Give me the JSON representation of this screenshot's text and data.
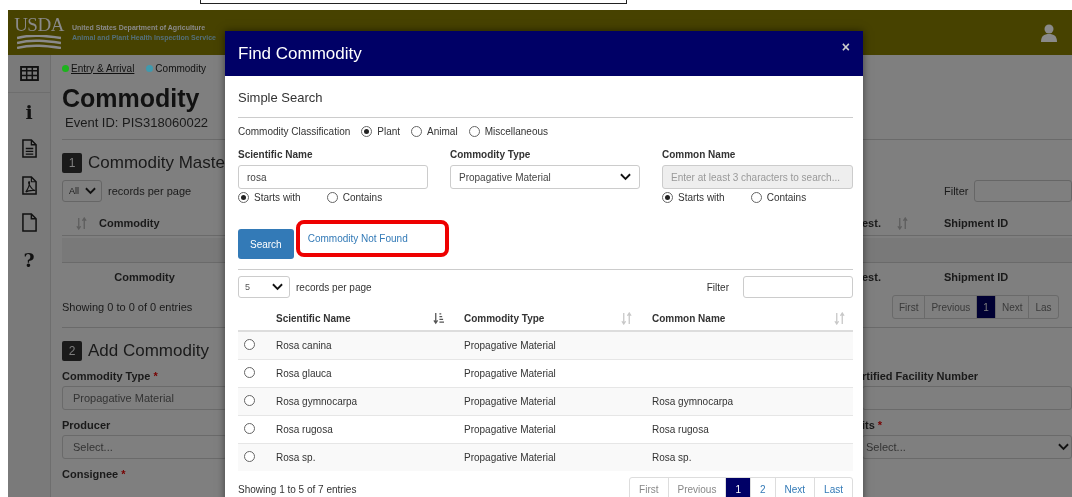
{
  "header": {
    "logo": "USDA",
    "title": "United States Department of Agriculture",
    "subtitle": "Animal and Plant Health Inspection Service"
  },
  "sidebar": {
    "items": [
      {
        "kind": "table"
      },
      {
        "kind": "glyph",
        "glyph": "i"
      },
      {
        "kind": "document"
      },
      {
        "kind": "pdf"
      },
      {
        "kind": "file"
      },
      {
        "kind": "glyph",
        "glyph": "?"
      }
    ]
  },
  "page": {
    "breadcrumbs": [
      {
        "label": "Entry & Arrival",
        "color": "#1db41d",
        "link": true
      },
      {
        "label": "Commodity",
        "color": "#3f9aae",
        "link": false
      }
    ],
    "title": "Commodity",
    "event_id": "Event ID: PIS318060022",
    "master": {
      "number": "1",
      "title": "Commodity Maste",
      "length_value": "All",
      "length_label": "records per page",
      "filter_label": "Filter",
      "columns_left": [
        {
          "label": "Commodity",
          "sorted": false
        }
      ],
      "columns_right": [
        {
          "label": "est.",
          "sorted": false
        },
        {
          "label": "Shipment ID"
        }
      ],
      "footer_left": [
        "Commodity"
      ],
      "footer_right": [
        "est.",
        "Shipment ID"
      ],
      "info": "Showing 0 to 0 of 0 entries",
      "pagination": [
        {
          "label": "First",
          "selected": false
        },
        {
          "label": "Previous",
          "selected": false
        },
        {
          "label": "1",
          "selected": true
        },
        {
          "label": "Next",
          "selected": false
        },
        {
          "label": "Las",
          "selected": false
        }
      ]
    },
    "add": {
      "number": "2",
      "title": "Add Commodity",
      "fields_left": [
        {
          "label": "Commodity Type",
          "required_mark": "*",
          "kind": "input",
          "value": "Propagative Material"
        },
        {
          "label": "Producer",
          "kind": "input",
          "placeholder": "Select..."
        },
        {
          "label": "Consignee",
          "required_mark": "*",
          "kind": "label"
        }
      ],
      "fields_right": [
        {
          "label": "rtified Facility Number",
          "kind": "input"
        },
        {
          "label": "its",
          "required_mark": "*",
          "kind": "select",
          "placeholder": "Select..."
        }
      ]
    }
  },
  "modal": {
    "title": "Find Commodity",
    "close": "×",
    "section": "Simple Search",
    "classification": {
      "label": "Commodity Classification",
      "options": [
        {
          "label": "Plant",
          "selected": true
        },
        {
          "label": "Animal",
          "selected": false
        },
        {
          "label": "Miscellaneous",
          "selected": false
        }
      ]
    },
    "fields": [
      {
        "label": "Scientific Name",
        "kind": "text",
        "value": "rosa",
        "disabled": false,
        "match": [
          {
            "label": "Starts with",
            "selected": true
          },
          {
            "label": "Contains",
            "selected": false
          }
        ]
      },
      {
        "label": "Commodity Type",
        "kind": "select",
        "value": "Propagative Material",
        "disabled": false
      },
      {
        "label": "Common Name",
        "kind": "text",
        "placeholder": "Enter at least 3 characters to search...",
        "disabled": true,
        "match": [
          {
            "label": "Starts with",
            "selected": true
          },
          {
            "label": "Contains",
            "selected": false
          }
        ]
      }
    ],
    "search_button": "Search",
    "not_found_link": "Commodity Not Found",
    "link_highlighted": true,
    "length": {
      "value": "5",
      "label": "records per page"
    },
    "filter_label": "Filter",
    "table": {
      "columns": [
        {
          "label": "Scientific Name",
          "sorted": true
        },
        {
          "label": "Commodity Type",
          "sorted": false
        },
        {
          "label": "Common Name",
          "sorted": false
        }
      ],
      "rows": [
        {
          "selected": false,
          "scientific_name": "Rosa canina",
          "commodity_type": "Propagative Material"
        },
        {
          "selected": false,
          "scientific_name": "Rosa glauca",
          "commodity_type": "Propagative Material"
        },
        {
          "selected": false,
          "scientific_name": "Rosa gymnocarpa",
          "commodity_type": "Propagative Material",
          "common_name": "Rosa gymnocarpa"
        },
        {
          "selected": false,
          "scientific_name": "Rosa rugosa",
          "commodity_type": "Propagative Material",
          "common_name": "Rosa rugosa"
        },
        {
          "selected": false,
          "scientific_name": "Rosa sp.",
          "commodity_type": "Propagative Material",
          "common_name": "Rosa sp."
        }
      ]
    },
    "info": "Showing 1 to 5 of 7 entries",
    "pagination": [
      {
        "label": "First",
        "selected": false,
        "disabled": true
      },
      {
        "label": "Previous",
        "selected": false,
        "disabled": true
      },
      {
        "label": "1",
        "selected": true,
        "disabled": false
      },
      {
        "label": "2",
        "selected": false,
        "disabled": false
      },
      {
        "label": "Next",
        "selected": false,
        "disabled": false
      },
      {
        "label": "Last",
        "selected": false,
        "disabled": false
      }
    ]
  }
}
